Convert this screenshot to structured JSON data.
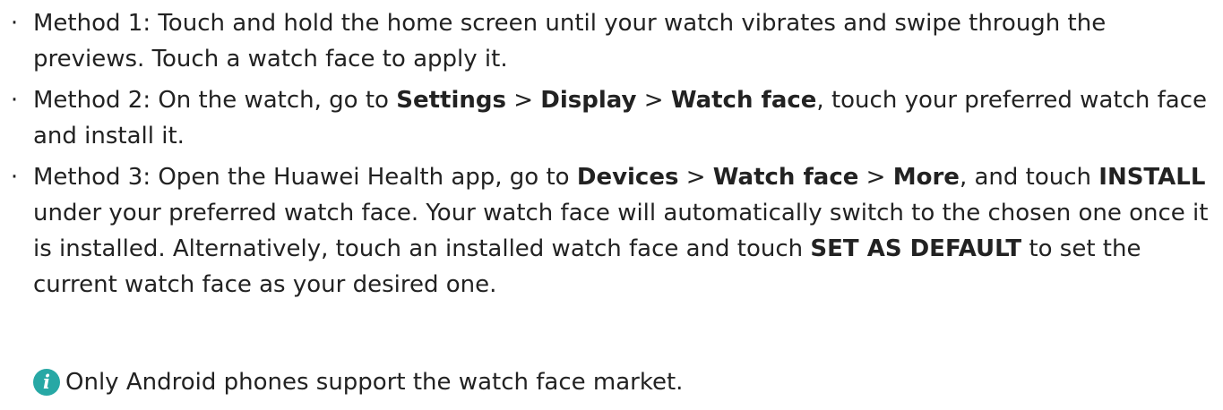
{
  "methods": [
    {
      "bullet": "·",
      "parts": [
        {
          "t": "Method 1: Touch and hold the home screen until your watch vibrates and swipe through the previews. Touch a watch face to apply it.",
          "b": false
        }
      ]
    },
    {
      "bullet": "·",
      "parts": [
        {
          "t": "Method 2: On the watch, go to ",
          "b": false
        },
        {
          "t": "Settings",
          "b": true
        },
        {
          "t": " > ",
          "b": false
        },
        {
          "t": "Display",
          "b": true
        },
        {
          "t": " > ",
          "b": false
        },
        {
          "t": "Watch face",
          "b": true
        },
        {
          "t": ", touch your preferred watch face and install it.",
          "b": false
        }
      ]
    },
    {
      "bullet": "·",
      "parts": [
        {
          "t": "Method 3: Open the Huawei Health app, go to ",
          "b": false
        },
        {
          "t": "Devices",
          "b": true
        },
        {
          "t": " > ",
          "b": false
        },
        {
          "t": "Watch face",
          "b": true
        },
        {
          "t": " > ",
          "b": false
        },
        {
          "t": "More",
          "b": true
        },
        {
          "t": ", and touch ",
          "b": false
        },
        {
          "t": "INSTALL",
          "b": true
        },
        {
          "t": " under your preferred watch face. Your watch face will automatically switch to the chosen one once it is installed. Alternatively, touch an installed watch face and touch ",
          "b": false
        },
        {
          "t": "SET AS DEFAULT",
          "b": true
        },
        {
          "t": " to set the current watch face as your desired one.",
          "b": false
        }
      ]
    }
  ],
  "note": {
    "icon": "info-icon",
    "icon_glyph": "i",
    "icon_color": "#27a8a5",
    "text": "Only Android phones support the watch face market."
  }
}
